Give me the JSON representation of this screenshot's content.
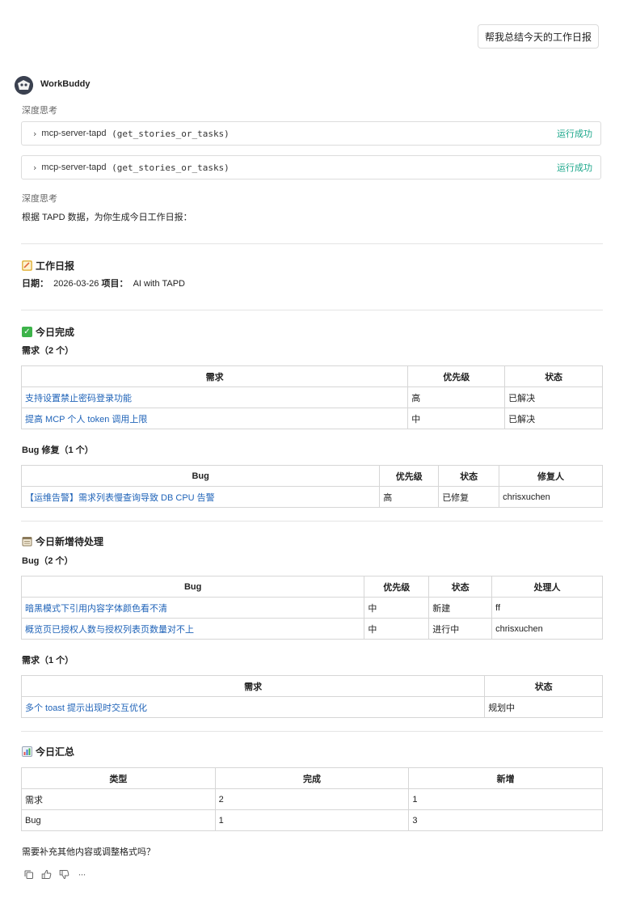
{
  "user_message": "帮我总结今天的工作日报",
  "bot": {
    "name": "WorkBuddy"
  },
  "thinking_label_1": "深度思考",
  "tool_calls": [
    {
      "name": "mcp-server-tapd",
      "args": "(get_stories_or_tasks)",
      "status": "运行成功"
    },
    {
      "name": "mcp-server-tapd",
      "args": "(get_stories_or_tasks)",
      "status": "运行成功"
    }
  ],
  "thinking_label_2": "深度思考",
  "intro": "根据 TAPD 数据，为你生成今日工作日报：",
  "report": {
    "title": "工作日报",
    "date_label": "日期：",
    "date": "2026-03-26",
    "project_label": "项目：",
    "project": "AI with TAPD"
  },
  "done": {
    "title": "今日完成",
    "stories_sub": "需求（2 个）",
    "stories_headers": [
      "需求",
      "优先级",
      "状态"
    ],
    "stories": [
      [
        "支持设置禁止密码登录功能",
        "高",
        "已解决"
      ],
      [
        "提高 MCP 个人 token 调用上限",
        "中",
        "已解决"
      ]
    ],
    "bugs_sub": "Bug 修复（1 个）",
    "bugs_headers": [
      "Bug",
      "优先级",
      "状态",
      "修复人"
    ],
    "bugs": [
      [
        "【运维告警】需求列表慢查询导致 DB CPU 告警",
        "高",
        "已修复",
        "chrisxuchen"
      ]
    ]
  },
  "new_items": {
    "title": "今日新增待处理",
    "bugs_sub": "Bug（2 个）",
    "bugs_headers": [
      "Bug",
      "优先级",
      "状态",
      "处理人"
    ],
    "bugs": [
      [
        "暗黑模式下引用内容字体颜色看不清",
        "中",
        "新建",
        "ff"
      ],
      [
        "概览页已授权人数与授权列表页数量对不上",
        "中",
        "进行中",
        "chrisxuchen"
      ]
    ],
    "stories_sub": "需求（1 个）",
    "stories_headers": [
      "需求",
      "状态"
    ],
    "stories": [
      [
        "多个 toast 提示出现时交互优化",
        "规划中"
      ]
    ]
  },
  "summary": {
    "title": "今日汇总",
    "headers": [
      "类型",
      "完成",
      "新增"
    ],
    "rows": [
      [
        "需求",
        "2",
        "1"
      ],
      [
        "Bug",
        "1",
        "3"
      ]
    ]
  },
  "closing": "需要补充其他内容或调整格式吗？",
  "colors": {
    "link": "#1f63b8",
    "success": "#1aa68a"
  },
  "action_icons": [
    "copy-icon",
    "thumbs-up-icon",
    "thumbs-down-icon",
    "more-icon"
  ]
}
